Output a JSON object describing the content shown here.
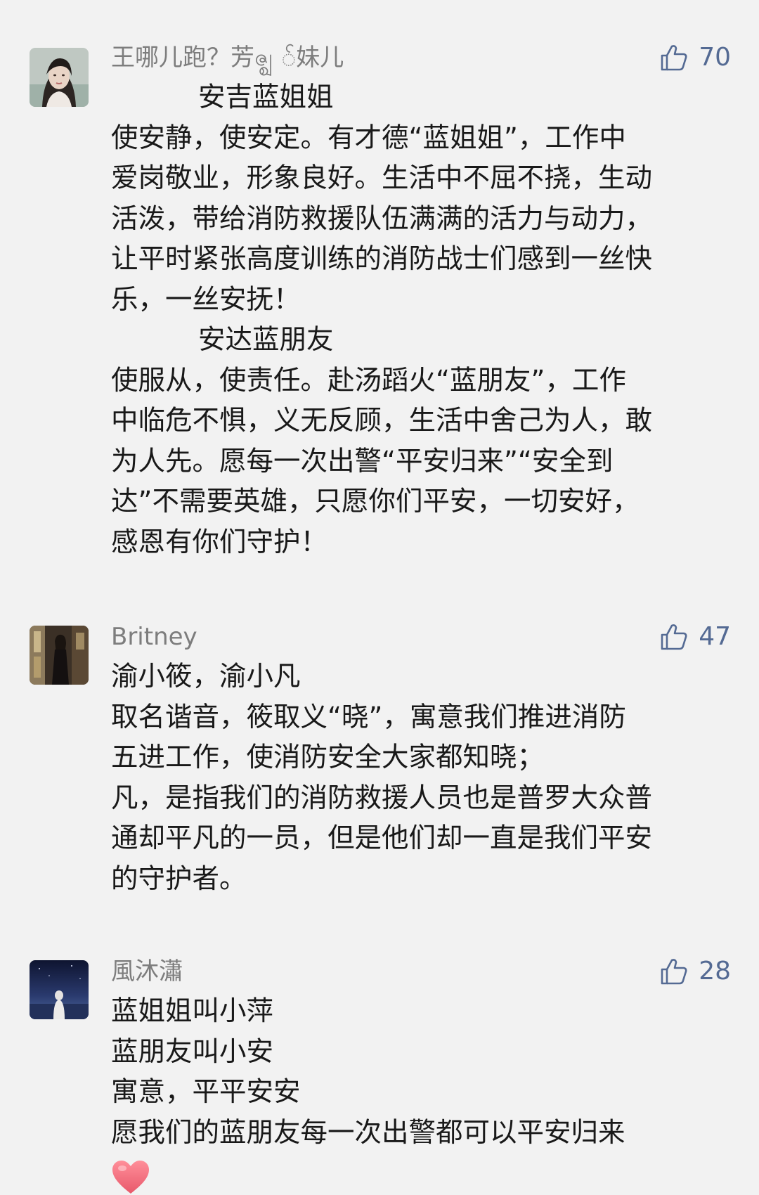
{
  "comments": [
    {
      "nickname": "王哪儿跑？芳ဇ္ဈ ်妹儿",
      "likes": "70",
      "avatar_icon": "avatar-girl-portrait",
      "lines": [
        "安吉蓝姐姐",
        "使安静，使安定。有才德“蓝姐姐”，工作中",
        "爱岗敬业，形象良好。生活中不屈不挠，生动",
        "活泼，带给消防救援队伍满满的活力与动力，",
        "让平时紧张高度训练的消防战士们感到一丝快",
        "乐，一丝安抚！",
        "安达蓝朋友",
        "使服从，使责任。赴汤蹈火“蓝朋友”，工作",
        "中临危不惧，义无反顾，生活中舍己为人，敢",
        "为人先。愿每一次出警“平安归来”“安全到",
        "达”不需要英雄，只愿你们平安，一切安好，",
        "感恩有你们守护！"
      ]
    },
    {
      "nickname": "Britney",
      "likes": "47",
      "avatar_icon": "avatar-woman-dark-room",
      "lines": [
        "渝小筱，渝小凡",
        "取名谐音，筱取义“晓”，寓意我们推进消防",
        "五进工作，使消防安全大家都知晓；",
        "凡，是指我们的消防救援人员也是普罗大众普",
        "通却平凡的一员，但是他们却一直是我们平安",
        "的守护者。"
      ]
    },
    {
      "nickname": "風沐瀟",
      "likes": "28",
      "avatar_icon": "avatar-night-sky-figure",
      "lines": [
        "蓝姐姐叫小萍",
        "蓝朋友叫小安",
        "寓意，平平安安",
        "愿我们的蓝朋友每一次出警都可以平安归来"
      ],
      "emoji_icon": "heart-icon"
    }
  ],
  "colors": {
    "background": "#f2f2f2",
    "nickname": "#7d7d7d",
    "body_text": "#191919",
    "like_accent": "#546a93",
    "heart": "#f06e7c"
  }
}
